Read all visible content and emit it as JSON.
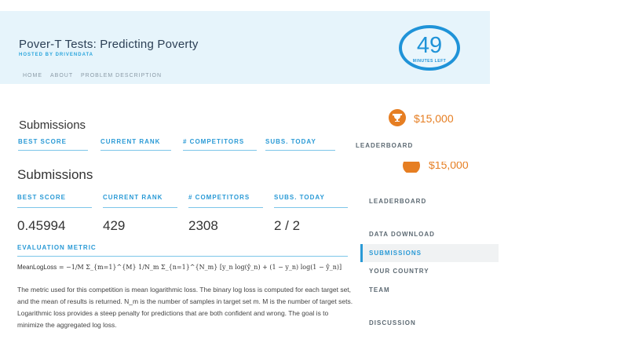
{
  "header": {
    "title": "Pover-T Tests: Predicting Poverty",
    "hosted_by": "HOSTED BY DRIVENDATA",
    "nav": [
      "HOME",
      "ABOUT",
      "PROBLEM DESCRIPTION"
    ],
    "timer": {
      "value": "49",
      "label": "MINUTES LEFT"
    }
  },
  "prize": {
    "amount": "$15,000",
    "icon": "trophy-icon",
    "color": "#e67e22"
  },
  "ghost": {
    "heading": "Submissions",
    "stats": [
      "BEST SCORE",
      "CURRENT RANK",
      "# COMPETITORS",
      "SUBS. TODAY"
    ],
    "sidebar_item": "LEADERBOARD",
    "prize_amount": "$15,000"
  },
  "main": {
    "heading": "Submissions",
    "stats": [
      {
        "label": "BEST SCORE",
        "value": "0.45994"
      },
      {
        "label": "CURRENT RANK",
        "value": "429"
      },
      {
        "label": "# COMPETITORS",
        "value": "2308"
      },
      {
        "label": "SUBS. TODAY",
        "value": "2 / 2"
      }
    ],
    "metric": {
      "label": "EVALUATION METRIC",
      "formula_name": "MeanLogLoss",
      "formula": "= −1/M Σ_{m=1}^{M} 1/N_m Σ_{n=1}^{N_m} [y_n log(ŷ_n) + (1 − y_n) log(1 − ŷ_n)]",
      "description": "The metric used for this competition is mean logarithmic loss. The binary log loss is computed for each target set, and the mean of results is returned. N_m is the number of samples in target set m. M is the number of target sets. Logarithmic loss provides a steep penalty for predictions that are both confident and wrong. The goal is to minimize the aggregated log loss."
    }
  },
  "sidebar": {
    "items": [
      "LEADERBOARD",
      "DATA DOWNLOAD",
      "SUBMISSIONS",
      "YOUR COUNTRY",
      "TEAM",
      "DISCUSSION"
    ],
    "active": "SUBMISSIONS"
  },
  "colors": {
    "accent": "#2a9ad6",
    "header_bg": "#e6f4fb",
    "timer": "#1f93d8"
  }
}
